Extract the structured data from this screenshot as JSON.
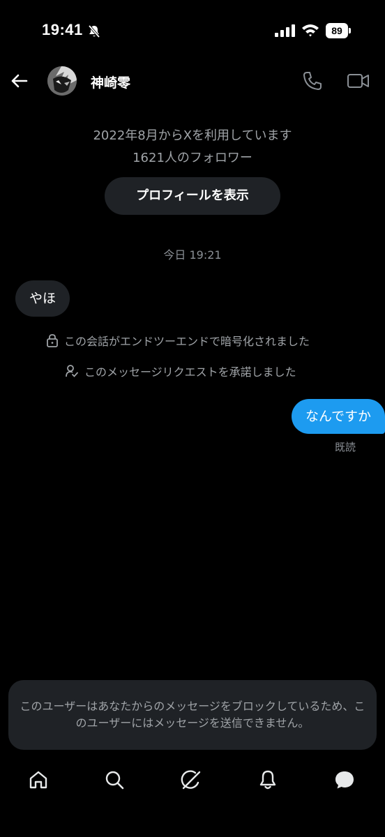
{
  "status_bar": {
    "time": "19:41",
    "battery": "89"
  },
  "header": {
    "contact_name": "神崎零"
  },
  "profile_info": {
    "joined": "2022年8月からXを利用しています",
    "followers": "1621人のフォロワー",
    "view_profile_label": "プロフィールを表示"
  },
  "conversation": {
    "timestamp": "今日 19:21",
    "incoming_message": "やほ",
    "system_encrypted": "この会話がエンドツーエンドで暗号化されました",
    "system_accepted": "このメッセージリクエストを承諾しました",
    "outgoing_message": "なんですか",
    "read_receipt": "既読"
  },
  "blocked_notice": "このユーザーはあなたからのメッセージをブロックしているため、このユーザーにはメッセージを送信できません。",
  "bottom_nav": {
    "items": [
      {
        "icon": "home-icon"
      },
      {
        "icon": "search-icon"
      },
      {
        "icon": "grok-icon"
      },
      {
        "icon": "bell-icon"
      },
      {
        "icon": "messages-icon"
      }
    ]
  },
  "colors": {
    "background": "#000000",
    "outgoing_bubble": "#1d9bf0",
    "incoming_bubble": "#1f2226",
    "secondary_text": "#a0a4a8"
  }
}
